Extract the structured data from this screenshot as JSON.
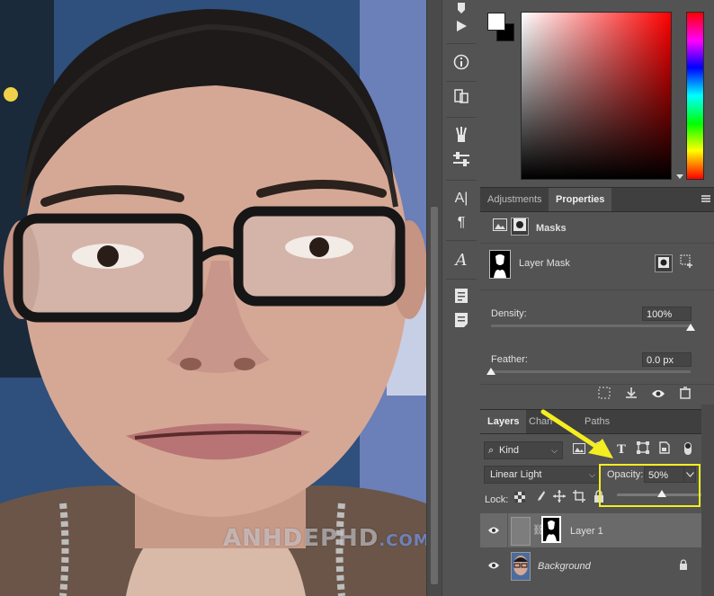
{
  "watermark": {
    "main": "ANHDEPHD",
    "domain": ".COM"
  },
  "tools": [
    {
      "icon": "history-brush-icon"
    },
    {
      "icon": "play-icon"
    },
    {
      "icon": "info-icon"
    },
    {
      "icon": "mobile-devices-icon"
    },
    {
      "icon": "brush-tip-icon"
    },
    {
      "icon": "adjust-sliders-icon"
    },
    {
      "icon": "character-icon",
      "glyph": "A|"
    },
    {
      "icon": "paragraph-icon",
      "glyph": "¶"
    },
    {
      "icon": "glyph-icon",
      "glyph": "A"
    },
    {
      "icon": "notes-icon"
    },
    {
      "icon": "notes-list-icon"
    }
  ],
  "color": {
    "foreground": "#ffffff",
    "background": "#000000"
  },
  "properties_panel": {
    "tabs": [
      "Adjustments",
      "Properties"
    ],
    "active_tab": "Properties",
    "section_title": "Masks",
    "mask_name": "Layer Mask",
    "density_label": "Density:",
    "density_value": "100%",
    "density_level": 1.0,
    "feather_label": "Feather:",
    "feather_value": "0.0 px",
    "feather_level": 0.0
  },
  "layers_panel": {
    "tabs": [
      "Layers",
      "Channels",
      "Paths"
    ],
    "tab_visible_text": [
      "Layers",
      "Chan",
      "Paths"
    ],
    "active_tab": "Layers",
    "filter_kind": "Kind",
    "blend_mode": "Linear Light",
    "opacity_label": "Opacity:",
    "opacity_value": "50%",
    "opacity_level": 0.5,
    "lock_label": "Lock:",
    "layers": [
      {
        "name": "Layer 1",
        "selected": true,
        "visible": true
      },
      {
        "name": "Background",
        "selected": false,
        "visible": true,
        "locked": true
      }
    ]
  },
  "annotation": {
    "arrow_color": "#f4ee20",
    "box_color": "#f4ee20"
  }
}
